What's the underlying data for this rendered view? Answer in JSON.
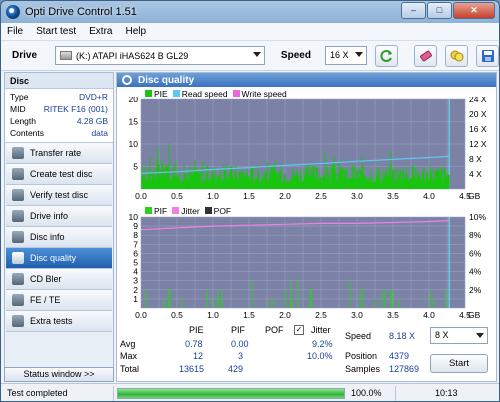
{
  "window": {
    "title": "Opti Drive Control 1.51",
    "btn_min": "–",
    "btn_max": "□",
    "btn_close": "✕"
  },
  "menu": [
    "File",
    "Start test",
    "Extra",
    "Help"
  ],
  "toolbar": {
    "drive_label": "Drive",
    "drive_value": "(K:)  ATAPI iHAS624   B GL29",
    "speed_label": "Speed",
    "speed_value": "16 X"
  },
  "sidebar": {
    "disc_header": "Disc",
    "info": [
      {
        "k": "Type",
        "v": "DVD+R"
      },
      {
        "k": "MID",
        "v": "RITEK F16 (001)"
      },
      {
        "k": "Length",
        "v": "4.28 GB"
      },
      {
        "k": "Contents",
        "v": "data"
      }
    ],
    "nav": [
      "Transfer rate",
      "Create test disc",
      "Verify test disc",
      "Drive info",
      "Disc info",
      "Disc quality",
      "CD Bler",
      "FE / TE",
      "Extra tests"
    ],
    "active_index": 5,
    "status_window": "Status window >>"
  },
  "panel": {
    "title": "Disc quality",
    "legend1": [
      "PIE",
      "Read speed",
      "Write speed"
    ],
    "legend2": [
      "PIF",
      "Jitter",
      "POF"
    ],
    "colors": {
      "pie": "#19c40f",
      "read": "#5cc8f2",
      "write": "#ee66dd",
      "pif": "#27d31a",
      "jitter": "#f080e6",
      "pof": "#333333"
    }
  },
  "chart_data": [
    {
      "type": "bar",
      "series": [
        {
          "name": "PIE",
          "values": []
        },
        {
          "name": "Read speed",
          "unit": "X",
          "x": [
            0,
            0.5,
            1,
            1.5,
            2,
            2.5,
            3,
            3.5,
            4,
            4.28
          ],
          "values": [
            4.2,
            4.6,
            5.2,
            5.7,
            6.3,
            6.8,
            7.4,
            7.9,
            8.4,
            8.7
          ]
        }
      ],
      "xlabel": "GB",
      "x_ticks": [
        "0.0",
        "0.5",
        "1.0",
        "1.5",
        "2.0",
        "2.5",
        "3.0",
        "3.5",
        "4.0",
        "4.5"
      ],
      "y_ticks_left": [
        "20",
        "15",
        "10",
        "5"
      ],
      "y_ticks_right": [
        "24 X",
        "20 X",
        "16 X",
        "12 X",
        "8 X",
        "4 X"
      ],
      "ylim": [
        0,
        20
      ],
      "ylim_right": [
        0,
        24
      ],
      "xlim": [
        0,
        4.5
      ]
    },
    {
      "type": "bar",
      "series": [
        {
          "name": "PIF",
          "values": []
        },
        {
          "name": "Jitter",
          "unit": "%",
          "x": [
            0,
            0.5,
            1,
            1.5,
            2,
            2.5,
            3,
            3.5,
            4,
            4.28
          ],
          "values": [
            8.6,
            8.8,
            9.0,
            9.1,
            9.2,
            9.3,
            9.3,
            9.4,
            9.5,
            9.6
          ]
        }
      ],
      "xlabel": "GB",
      "x_ticks": [
        "0.0",
        "0.5",
        "1.0",
        "1.5",
        "2.0",
        "2.5",
        "3.0",
        "3.5",
        "4.0",
        "4.5"
      ],
      "y_ticks_left": [
        "10",
        "9",
        "8",
        "7",
        "6",
        "5",
        "4",
        "3",
        "2",
        "1"
      ],
      "y_ticks_right": [
        "10%",
        "8%",
        "6%",
        "4%",
        "2%"
      ],
      "ylim": [
        0,
        10
      ],
      "ylim_right": [
        0,
        10
      ],
      "xlim": [
        0,
        4.5
      ]
    }
  ],
  "stats": {
    "headers": {
      "pie": "PIE",
      "pif": "PIF",
      "pof": "POF",
      "jitter": "Jitter"
    },
    "avg": {
      "label": "Avg",
      "pie": "0.78",
      "pif": "0.00",
      "jitter": "9.2%"
    },
    "max": {
      "label": "Max",
      "pie": "12",
      "pif": "3",
      "jitter": "10.0%"
    },
    "total": {
      "label": "Total",
      "pie": "13615",
      "pif": "429"
    },
    "speed_label": "Speed",
    "speed_value": "8.18 X",
    "position_label": "Position",
    "position_value": "4379",
    "samples_label": "Samples",
    "samples_value": "127869",
    "speed_select": "8 X",
    "start": "Start"
  },
  "status": {
    "text": "Test completed",
    "progress_pct": 100,
    "progress_text": "100.0%",
    "time": "10:13"
  }
}
